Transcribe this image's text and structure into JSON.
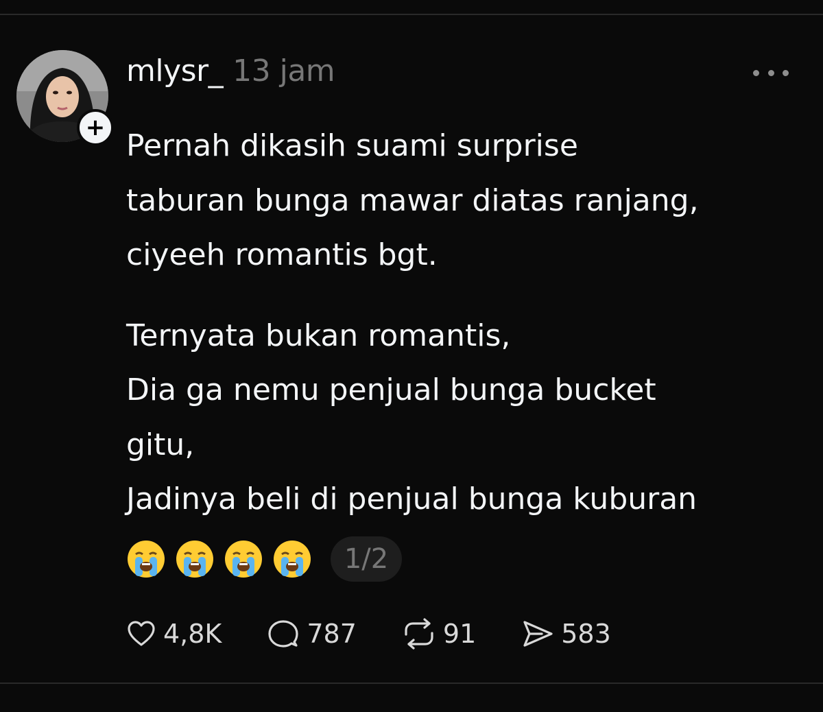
{
  "post": {
    "username": "mlysr_",
    "timestamp": "13 jam",
    "paragraph1": [
      "Pernah dikasih suami surprise",
      "taburan bunga mawar diatas ranjang,",
      "ciyeeh romantis bgt."
    ],
    "paragraph2": [
      "Ternyata bukan romantis,",
      "Dia ga nemu penjual bunga bucket",
      "gitu,",
      "Jadinya beli di penjual bunga kuburan"
    ],
    "emojis": [
      "😭",
      "😭",
      "😭",
      "😭"
    ],
    "page_indicator": "1/2"
  },
  "actions": {
    "likes": "4,8K",
    "replies": "787",
    "reposts": "91",
    "shares": "583"
  },
  "icons": {
    "follow": "plus-icon",
    "more": "more-horizontal-icon",
    "like": "heart-icon",
    "reply": "comment-icon",
    "repost": "repost-icon",
    "share": "send-icon"
  }
}
